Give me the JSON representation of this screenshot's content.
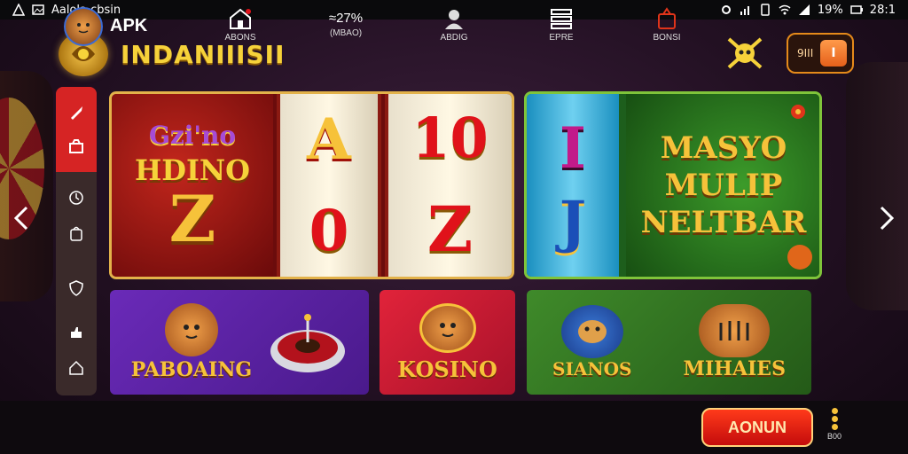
{
  "status_bar": {
    "app_label": "Aalola cbsin",
    "battery": "19%",
    "time": "28:1"
  },
  "header": {
    "brand": "INDANIIISII",
    "toggle_text": "9III",
    "toggle_knob": "I"
  },
  "banners": {
    "slot": {
      "title": "Gzi'no",
      "subtitle": "HDINO",
      "big_symbol": "Z",
      "reel1": [
        "A",
        "0"
      ],
      "reel2": [
        "10",
        "Z"
      ]
    },
    "green": {
      "reel_symbols": [
        "I",
        "J"
      ],
      "lines": [
        "MASYO",
        "MULIP",
        "NELTBAR"
      ]
    }
  },
  "tiles": [
    {
      "label": "PABOAING"
    },
    {
      "label": "KOSINO"
    },
    {
      "label_left": "SIANOS",
      "label_right": "MIHAIES"
    }
  ],
  "bottom_nav": {
    "apk_label": "APK",
    "items": [
      {
        "label": "ABONS"
      },
      {
        "value": "≈27%",
        "label": "(MBAO)"
      },
      {
        "label": "ABDIG"
      },
      {
        "label": "EPRE"
      },
      {
        "label": "BONSI"
      }
    ],
    "cta": "AONUN",
    "more_label": "B00"
  },
  "colors": {
    "accent_gold": "#f6c23a",
    "accent_red": "#d62424",
    "accent_orange": "#e58a1a"
  }
}
